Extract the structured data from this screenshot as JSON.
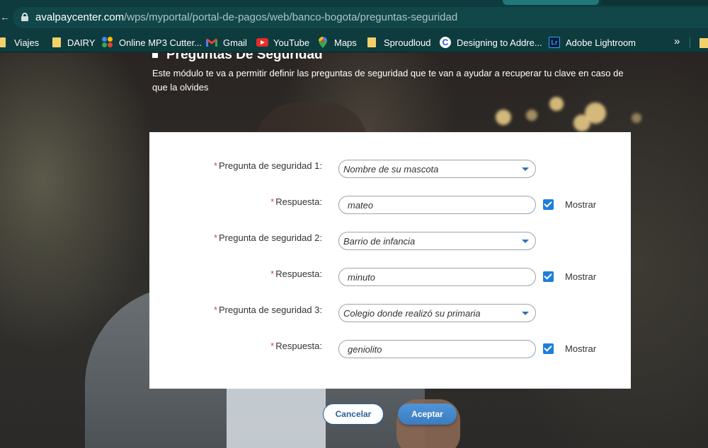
{
  "browser": {
    "url_domain": "avalpaycenter.com",
    "url_path": "/wps/myportal/portal-de-pagos/web/banco-bogota/preguntas-seguridad",
    "bookmarks": [
      {
        "label": "Viajes",
        "icon": "folder-icon"
      },
      {
        "label": "DAIRY",
        "icon": "folder-icon"
      },
      {
        "label": "Online MP3 Cutter...",
        "icon": "mp3-cutter-icon"
      },
      {
        "label": "Gmail",
        "icon": "gmail-icon"
      },
      {
        "label": "YouTube",
        "icon": "youtube-icon"
      },
      {
        "label": "Maps",
        "icon": "maps-icon"
      },
      {
        "label": "Sproudloud",
        "icon": "folder-icon"
      },
      {
        "label": "Designing to Addre...",
        "icon": "c-icon"
      },
      {
        "label": "Adobe Lightroom",
        "icon": "lightroom-icon"
      }
    ],
    "overflow": "»",
    "lr_text": "Lr",
    "c_text": "C"
  },
  "page": {
    "title": "Preguntas De Seguridad",
    "description": "Este módulo te va a permitir definir las preguntas de seguridad que te van a ayudar a recuperar tu clave en caso de que la olvides",
    "required_mark": "*",
    "form": {
      "q1_label": "Pregunta de seguridad 1:",
      "q1_value": "Nombre de su mascota",
      "a1_label": "Respuesta:",
      "a1_value": "mateo",
      "q2_label": "Pregunta de seguridad 2:",
      "q2_value": "Barrio de infancia",
      "a2_label": "Respuesta:",
      "a2_value": "minuto",
      "q3_label": "Pregunta de seguridad 3:",
      "q3_value": "Colegio donde realizó su primaria",
      "a3_label": "Respuesta:",
      "a3_value": "geniolito",
      "show_label": "Mostrar",
      "show_checked": true
    },
    "buttons": {
      "cancel": "Cancelar",
      "accept": "Aceptar"
    }
  },
  "colors": {
    "chrome": "#0e3b3d",
    "accent": "#1e7fd9",
    "required": "#d9463f",
    "button_primary": "#3a7cc0"
  }
}
